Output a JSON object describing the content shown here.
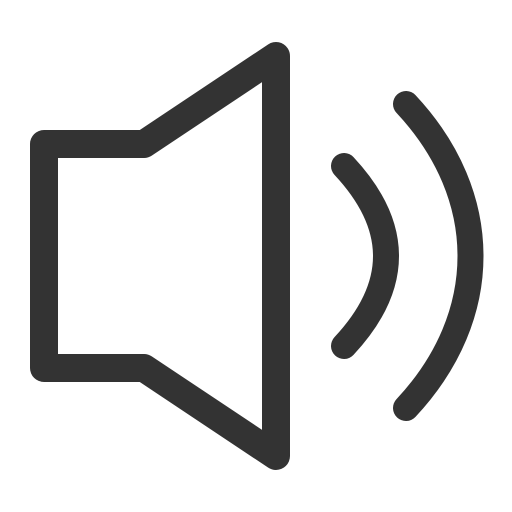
{
  "icon": {
    "name": "speaker-volume-icon",
    "stroke_color": "#333333",
    "background_color": "#ffffff"
  }
}
